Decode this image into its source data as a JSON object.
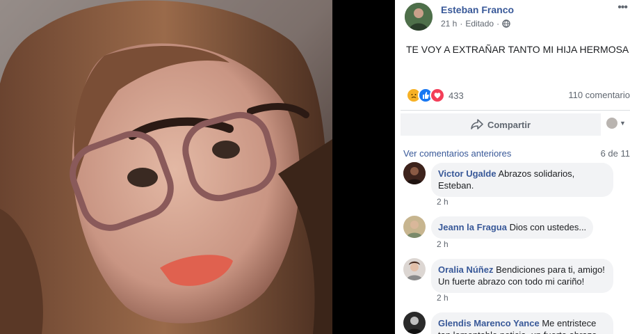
{
  "post": {
    "author": "Esteban Franco",
    "time": "21 h",
    "edited": "Editado",
    "text": "TE VOY A EXTRAÑAR TANTO MI HIJA HERMOSA !",
    "reaction_count": "433",
    "comment_count": "110 comentario"
  },
  "actions": {
    "share": "Compartir"
  },
  "comments_section": {
    "prev_link": "Ver comentarios anteriores",
    "pager": "6 de 11",
    "comments": [
      {
        "author": "Victor Ugalde",
        "text": "Abrazos solidarios, Esteban.",
        "time": "2 h"
      },
      {
        "author": "Jeann la Fragua",
        "text": "Dios con ustedes...",
        "time": "2 h"
      },
      {
        "author": "Oralia Núñez",
        "text": "Bendiciones para ti, amigo! Un fuerte abrazo con todo mi cariño!",
        "time": "2 h"
      },
      {
        "author": "Glendis Marenco Yance",
        "text": "Me entristece tan lamentable noticia, un fuerte abrazo",
        "time": ""
      }
    ]
  },
  "colors": {
    "link_blue": "#385898",
    "meta_gray": "#606770",
    "bubble_bg": "#f2f3f5"
  }
}
